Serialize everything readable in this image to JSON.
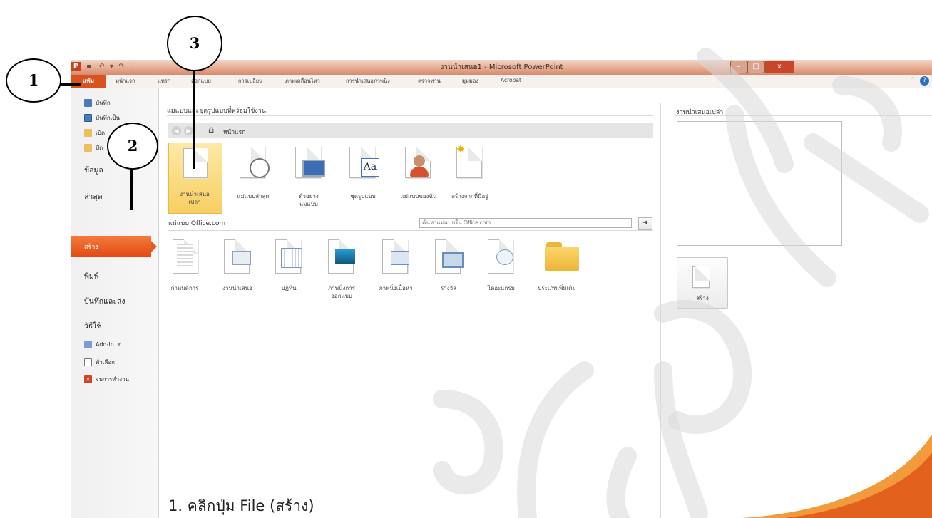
{
  "window": {
    "title": "งานนำเสนอ1 - Microsoft PowerPoint",
    "controls": {
      "minimize": "–",
      "maximize": "□",
      "close": "x"
    },
    "help_icon": "?"
  },
  "ribbon": {
    "file_tab": "แฟ้ม",
    "tabs": [
      "หน้าแรก",
      "แทรก",
      "ออกแบบ",
      "การเปลี่ยน",
      "ภาพเคลื่อนไหว",
      "การนำเสนอภาพนิ่ง",
      "ตรวจทาน",
      "มุมมอง",
      "Acrobat"
    ]
  },
  "nav": {
    "small_items": [
      {
        "label": "บันทึก",
        "icon": "save-icon"
      },
      {
        "label": "บันทึกเป็น",
        "icon": "save-as-icon"
      },
      {
        "label": "เปิด",
        "icon": "open-folder-icon"
      },
      {
        "label": "ปิด",
        "icon": "close-folder-icon"
      }
    ],
    "info": "ข้อมูล",
    "recent": "ล่าสุด",
    "create": "สร้าง",
    "print": "พิมพ์",
    "save_send": "บันทึกและส่ง",
    "help": "วิธีใช้",
    "addin": "Add-In",
    "options": "ตัวเลือก",
    "exit": "จบการทำงาน"
  },
  "main": {
    "heading": "แม่แบบและชุดรูปแบบที่พร้อมใช้งาน",
    "breadcrumb": "หน้าแรก",
    "top_tiles": [
      {
        "label1": "งานนำเสนอ",
        "label2": "เปล่า",
        "icon": "blank-document-icon"
      },
      {
        "label1": "แม่แบบล่าสุด",
        "label2": "",
        "icon": "recent-templates-icon"
      },
      {
        "label1": "ตัวอย่าง",
        "label2": "แม่แบบ",
        "icon": "sample-templates-icon"
      },
      {
        "label1": "ชุดรูปแบบ",
        "label2": "",
        "icon": "themes-icon"
      },
      {
        "label1": "แม่แบบของฉัน",
        "label2": "",
        "icon": "my-templates-icon"
      },
      {
        "label1": "สร้างจากที่มีอยู่",
        "label2": "",
        "icon": "new-from-existing-icon"
      }
    ],
    "office_heading": "แม่แบบ Office.com",
    "search_placeholder": "ค้นหาแม่แบบใน Office.com",
    "search_go": "➜",
    "office_tiles": [
      {
        "label1": "กำหนดการ",
        "label2": "",
        "icon": "agenda-icon"
      },
      {
        "label1": "งานนำเสนอ",
        "label2": "",
        "icon": "presentation-icon"
      },
      {
        "label1": "ปฏิทิน",
        "label2": "",
        "icon": "calendar-icon"
      },
      {
        "label1": "ภาพนิ่งการ",
        "label2": "ออกแบบ",
        "icon": "design-slides-icon"
      },
      {
        "label1": "ภาพนิ่งเนื้อหา",
        "label2": "",
        "icon": "content-slides-icon"
      },
      {
        "label1": "รางวัล",
        "label2": "",
        "icon": "award-icon"
      },
      {
        "label1": "ไดอะแกรม",
        "label2": "",
        "icon": "diagram-icon"
      },
      {
        "label1": "ประเภทเพิ่มเติม",
        "label2": "",
        "icon": "folder-icon"
      }
    ]
  },
  "right": {
    "heading": "งานนำเสนอเปล่า",
    "create_label": "สร้าง"
  },
  "callouts": [
    "1",
    "2",
    "3"
  ],
  "caption": "1.   คลิกปุ่ม File (สร้าง)",
  "colors": {
    "accent": "#e24a12",
    "title_bar": "#e7b39b",
    "highlight_tile": "#f8cf61"
  }
}
